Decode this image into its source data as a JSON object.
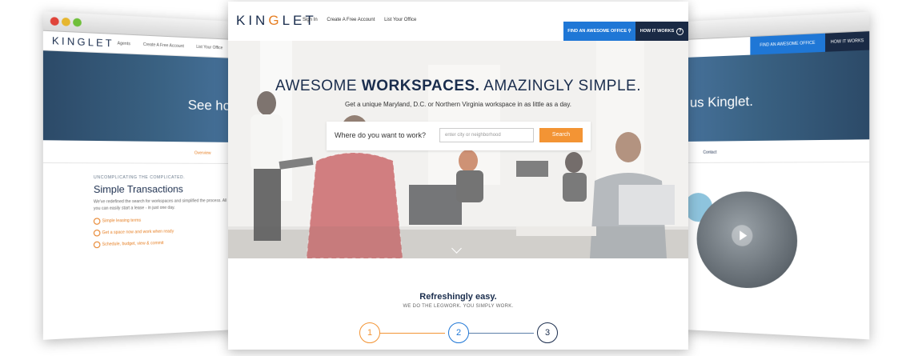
{
  "colors": {
    "navy": "#1a2d4d",
    "orange": "#f39434",
    "blue": "#1f77d6"
  },
  "left_window": {
    "logo": "KINGLET",
    "nav": [
      "Agents",
      "Create A Free Account",
      "List Your Office"
    ],
    "banner_text": "See how",
    "subtab": "Overview",
    "kicker": "UNCOMPLICATING THE COMPLICATED.",
    "heading": "Simple Transactions",
    "paragraph": "We've redefined the search for workspaces and simplified the process. All you can easily start a lease - in just one day.",
    "items": [
      "Simple leasing terms",
      "Get a space now and work when ready",
      "Schedule, budget, view & commit"
    ]
  },
  "right_window": {
    "find_button": "FIND AN AWESOME OFFICE",
    "how_button": "HOW IT WORKS",
    "banner_text": "s us Kinglet.",
    "subtab": "Contact"
  },
  "main": {
    "logo_pre": "KIN",
    "logo_g": "G",
    "logo_post": "LET",
    "nav": [
      "Sign In",
      "Create A Free Account",
      "List Your Office"
    ],
    "find_button": "FIND AN AWESOME OFFICE",
    "how_button": "HOW IT WORKS",
    "hero_title_1": "AWESOME ",
    "hero_title_2": "WORKSPACES.",
    "hero_title_3": " AMAZINGLY SIMPLE.",
    "hero_sub": "Get a unique Maryland, D.C. or Northern Virginia workspace in as little as a day.",
    "search_label": "Where do you want to work?",
    "search_placeholder": "enter city or neighborhood",
    "search_button": "Search",
    "section_title": "Refreshingly easy.",
    "section_sub": "WE DO THE LEGWORK. YOU SIMPLY WORK.",
    "steps": [
      "1",
      "2",
      "3"
    ]
  }
}
